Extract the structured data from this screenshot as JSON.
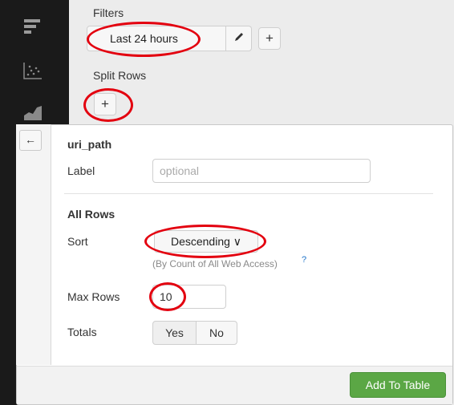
{
  "filters": {
    "section_label": "Filters",
    "time_range": "Last 24 hours",
    "edit_icon": "pencil-icon",
    "add_label": "+"
  },
  "split_rows": {
    "section_label": "Split Rows",
    "add_label": "+"
  },
  "panel": {
    "back_label": "←",
    "field_name": "uri_path",
    "label_field": {
      "label": "Label",
      "placeholder": "optional",
      "value": ""
    },
    "all_rows_heading": "All Rows",
    "sort": {
      "label": "Sort",
      "value": "Descending ∨",
      "hint": "(By Count of All Web Access)",
      "help": "?"
    },
    "max_rows": {
      "label": "Max Rows",
      "value": "10"
    },
    "totals": {
      "label": "Totals",
      "yes": "Yes",
      "no": "No"
    },
    "add_button": "Add To Table"
  },
  "colors": {
    "highlight": "#e3000f",
    "primary_button": "#5ba745",
    "rail": "#1a1a1a"
  },
  "rail_icons": [
    "list-icon",
    "scatter-chart-icon",
    "area-chart-icon"
  ]
}
